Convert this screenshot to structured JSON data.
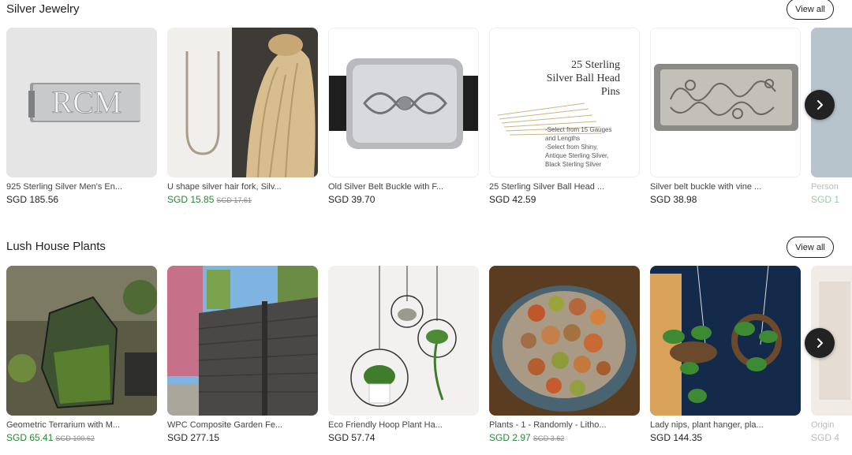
{
  "sections": [
    {
      "title": "Silver Jewelry",
      "view_all": "View all",
      "items": [
        {
          "title": "925 Sterling Silver Men's En...",
          "price": "SGD 185.56",
          "original": "",
          "image_text": "RCM"
        },
        {
          "title": "U shape silver hair fork, Silv...",
          "price": "SGD 15.85",
          "original": "SGD 17.61",
          "image_text": ""
        },
        {
          "title": "Old Silver Belt Buckle with F...",
          "price": "SGD 39.70",
          "original": "",
          "image_text": ""
        },
        {
          "title": "25 Sterling Silver Ball Head ...",
          "price": "SGD 42.59",
          "original": "",
          "image_text": "25 Sterling Silver Ball Head Pins"
        },
        {
          "title": "Silver belt buckle with vine ...",
          "price": "SGD 38.98",
          "original": "",
          "image_text": ""
        },
        {
          "title": "Person",
          "price": "SGD 1",
          "original": "",
          "image_text": ""
        }
      ],
      "next_icon": "chevron-right-icon"
    },
    {
      "title": "Lush House Plants",
      "view_all": "View all",
      "items": [
        {
          "title": "Geometric Terrarium with M...",
          "price": "SGD 65.41",
          "original": "SGD 100.62",
          "image_text": ""
        },
        {
          "title": "WPC Composite Garden Fe...",
          "price": "SGD 277.15",
          "original": "",
          "image_text": ""
        },
        {
          "title": "Eco Friendly Hoop Plant Ha...",
          "price": "SGD 57.74",
          "original": "",
          "image_text": ""
        },
        {
          "title": "Plants - 1 - Randomly - Litho...",
          "price": "SGD 2.97",
          "original": "SGD 3.62",
          "image_text": ""
        },
        {
          "title": "Lady nips, plant hanger, pla...",
          "price": "SGD 144.35",
          "original": "",
          "image_text": ""
        },
        {
          "title": "Origin",
          "price": "SGD 4",
          "original": "",
          "image_text": ""
        }
      ],
      "next_icon": "chevron-right-icon"
    }
  ],
  "colors": {
    "sale_price": "#258635",
    "text": "#222222",
    "muted": "#888888"
  }
}
